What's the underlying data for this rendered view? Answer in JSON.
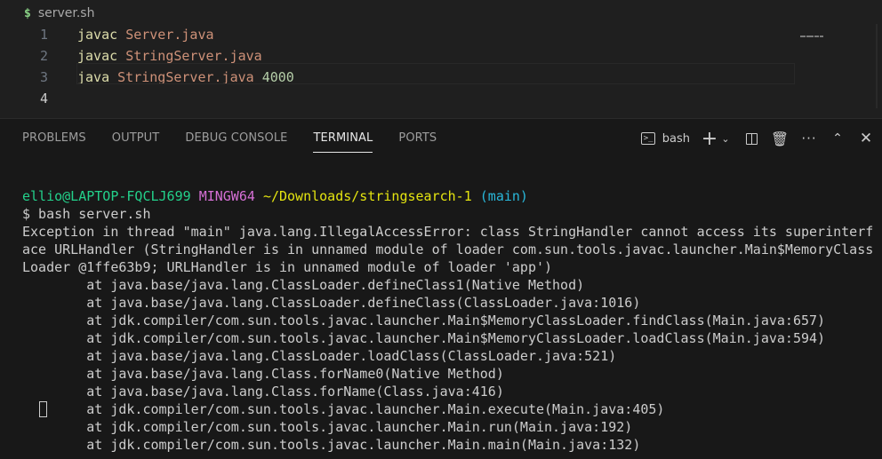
{
  "editor": {
    "breadcrumb_icon": "$",
    "file_name": "server.sh",
    "lines": [
      {
        "num": "1",
        "cmd": "javac",
        "arg": "Server.java",
        "num_arg": ""
      },
      {
        "num": "2",
        "cmd": "javac",
        "arg": "StringServer.java",
        "num_arg": ""
      },
      {
        "num": "3",
        "cmd": "java",
        "arg": "StringServer.java",
        "num_arg": "4000"
      },
      {
        "num": "4",
        "cmd": "",
        "arg": "",
        "num_arg": ""
      }
    ]
  },
  "panel": {
    "tabs": [
      "PROBLEMS",
      "OUTPUT",
      "DEBUG CONSOLE",
      "TERMINAL",
      "PORTS"
    ],
    "active_tab": "TERMINAL",
    "terminal_name": "bash",
    "icons": [
      "terminal-icon",
      "plus-icon",
      "chevron-down-icon",
      "split-icon",
      "trash-icon",
      "more-icon",
      "chevron-up-icon",
      "close-icon"
    ]
  },
  "terminal": {
    "prompt_user": "ellio@LAPTOP-FQCLJ699",
    "prompt_env": "MINGW64",
    "prompt_path": "~/Downloads/stringsearch-1",
    "prompt_branch": "(main)",
    "command": "$ bash server.sh",
    "output": [
      "Exception in thread \"main\" java.lang.IllegalAccessError: class StringHandler cannot access its superinterf",
      "ace URLHandler (StringHandler is in unnamed module of loader com.sun.tools.javac.launcher.Main$MemoryClass",
      "Loader @1ffe63b9; URLHandler is in unnamed module of loader 'app')",
      "        at java.base/java.lang.ClassLoader.defineClass1(Native Method)",
      "        at java.base/java.lang.ClassLoader.defineClass(ClassLoader.java:1016)",
      "        at jdk.compiler/com.sun.tools.javac.launcher.Main$MemoryClassLoader.findClass(Main.java:657)",
      "        at jdk.compiler/com.sun.tools.javac.launcher.Main$MemoryClassLoader.loadClass(Main.java:594)",
      "        at java.base/java.lang.ClassLoader.loadClass(ClassLoader.java:521)",
      "        at java.base/java.lang.Class.forName0(Native Method)",
      "        at java.base/java.lang.Class.forName(Class.java:416)",
      "        at jdk.compiler/com.sun.tools.javac.launcher.Main.execute(Main.java:405)",
      "        at jdk.compiler/com.sun.tools.javac.launcher.Main.run(Main.java:192)",
      "        at jdk.compiler/com.sun.tools.javac.launcher.Main.main(Main.java:132)"
    ]
  },
  "colors": {
    "background": "#1f1f1f",
    "panel_background": "#181818",
    "prompt_user": "#23d18b",
    "prompt_env": "#d670d6",
    "prompt_path": "#e5e510",
    "prompt_branch": "#29b8db"
  }
}
